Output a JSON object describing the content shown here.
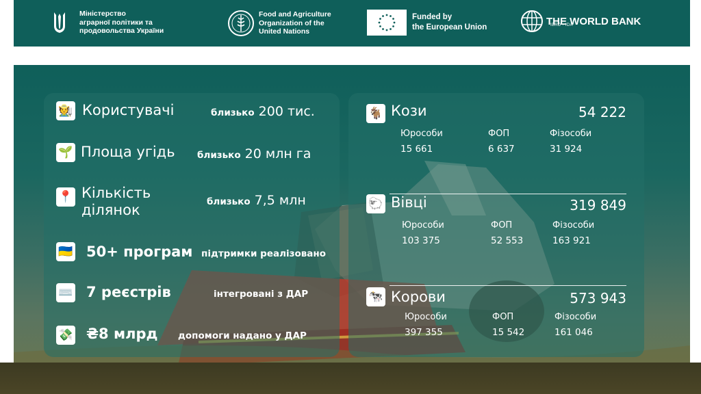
{
  "header": {
    "ministry": {
      "line1": "Міністерство",
      "line2": "аграрної політики та",
      "line3": "продовольства України",
      "icon": "trident-icon"
    },
    "fao": {
      "line1": "Food and Agriculture",
      "line2": "Organization of the",
      "line3": "United Nations",
      "icon": "fao-seal-icon"
    },
    "eu": {
      "line1": "Funded by",
      "line2": "the European Union",
      "icon": "eu-flag-icon"
    },
    "worldbank": {
      "title": "THE WORLD BANK",
      "subtitle": "IBRD • IDA",
      "icon": "globe-icon"
    }
  },
  "stats": [
    {
      "icon": "🧑‍🌾",
      "label": "Користувачі",
      "prefix": "близько",
      "value": "200 тис."
    },
    {
      "icon": "🌱",
      "label": "Площа угідь",
      "prefix": "близько",
      "value": "20 млн га"
    },
    {
      "icon": "📍",
      "label": "Кількість ділянок",
      "prefix": "близько",
      "value": "7,5 млн"
    },
    {
      "icon": "🇺🇦",
      "label": "50+ програм",
      "note": "підтримки реалізовано"
    },
    {
      "icon": "⌨️",
      "label": "7 реєстрів",
      "note": "інтегровані з ДАР"
    },
    {
      "icon": "💸",
      "label": "₴8 млрд",
      "note": "допомоги надано у ДАР"
    }
  ],
  "animals": [
    {
      "icon": "🐐",
      "name": "Кози",
      "total": "54 222",
      "columns": [
        "Юрособи",
        "ФОП",
        "Фізособи"
      ],
      "values": [
        "15 661",
        "6 637",
        "31 924"
      ]
    },
    {
      "icon": "🐑",
      "name": "Вівці",
      "total": "319 849",
      "columns": [
        "Юрособи",
        "ФОП",
        "Фізособи"
      ],
      "values": [
        "103 375",
        "52 553",
        "163 921"
      ]
    },
    {
      "icon": "🐄",
      "name": "Корови",
      "total": "573 943",
      "columns": [
        "Юрособи",
        "ФОП",
        "Фізособи"
      ],
      "values": [
        "397 355",
        "15 542",
        "161 046"
      ]
    }
  ],
  "colors": {
    "header_bg": "#0f5f5a",
    "panel_bg": "#1b6760",
    "card_bg": "#237068",
    "harvester_red": "#c0392b"
  }
}
